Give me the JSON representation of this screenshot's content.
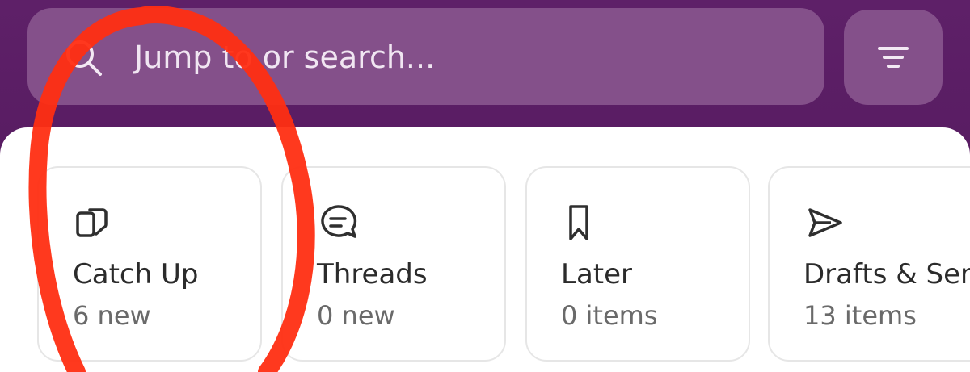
{
  "colors": {
    "header_bg": "#5b1d63",
    "search_bg": "#84508a",
    "annotation": "#ff2e12"
  },
  "search": {
    "placeholder": "Jump to or search...",
    "icon": "search-icon"
  },
  "filter": {
    "icon": "filter-icon"
  },
  "cards": [
    {
      "title": "Catch Up",
      "subtitle": "6 new",
      "icon": "catch-up-icon"
    },
    {
      "title": "Threads",
      "subtitle": "0 new",
      "icon": "threads-icon"
    },
    {
      "title": "Later",
      "subtitle": "0 items",
      "icon": "bookmark-icon"
    },
    {
      "title": "Drafts & Sent",
      "subtitle": "13 items",
      "icon": "send-icon"
    }
  ]
}
